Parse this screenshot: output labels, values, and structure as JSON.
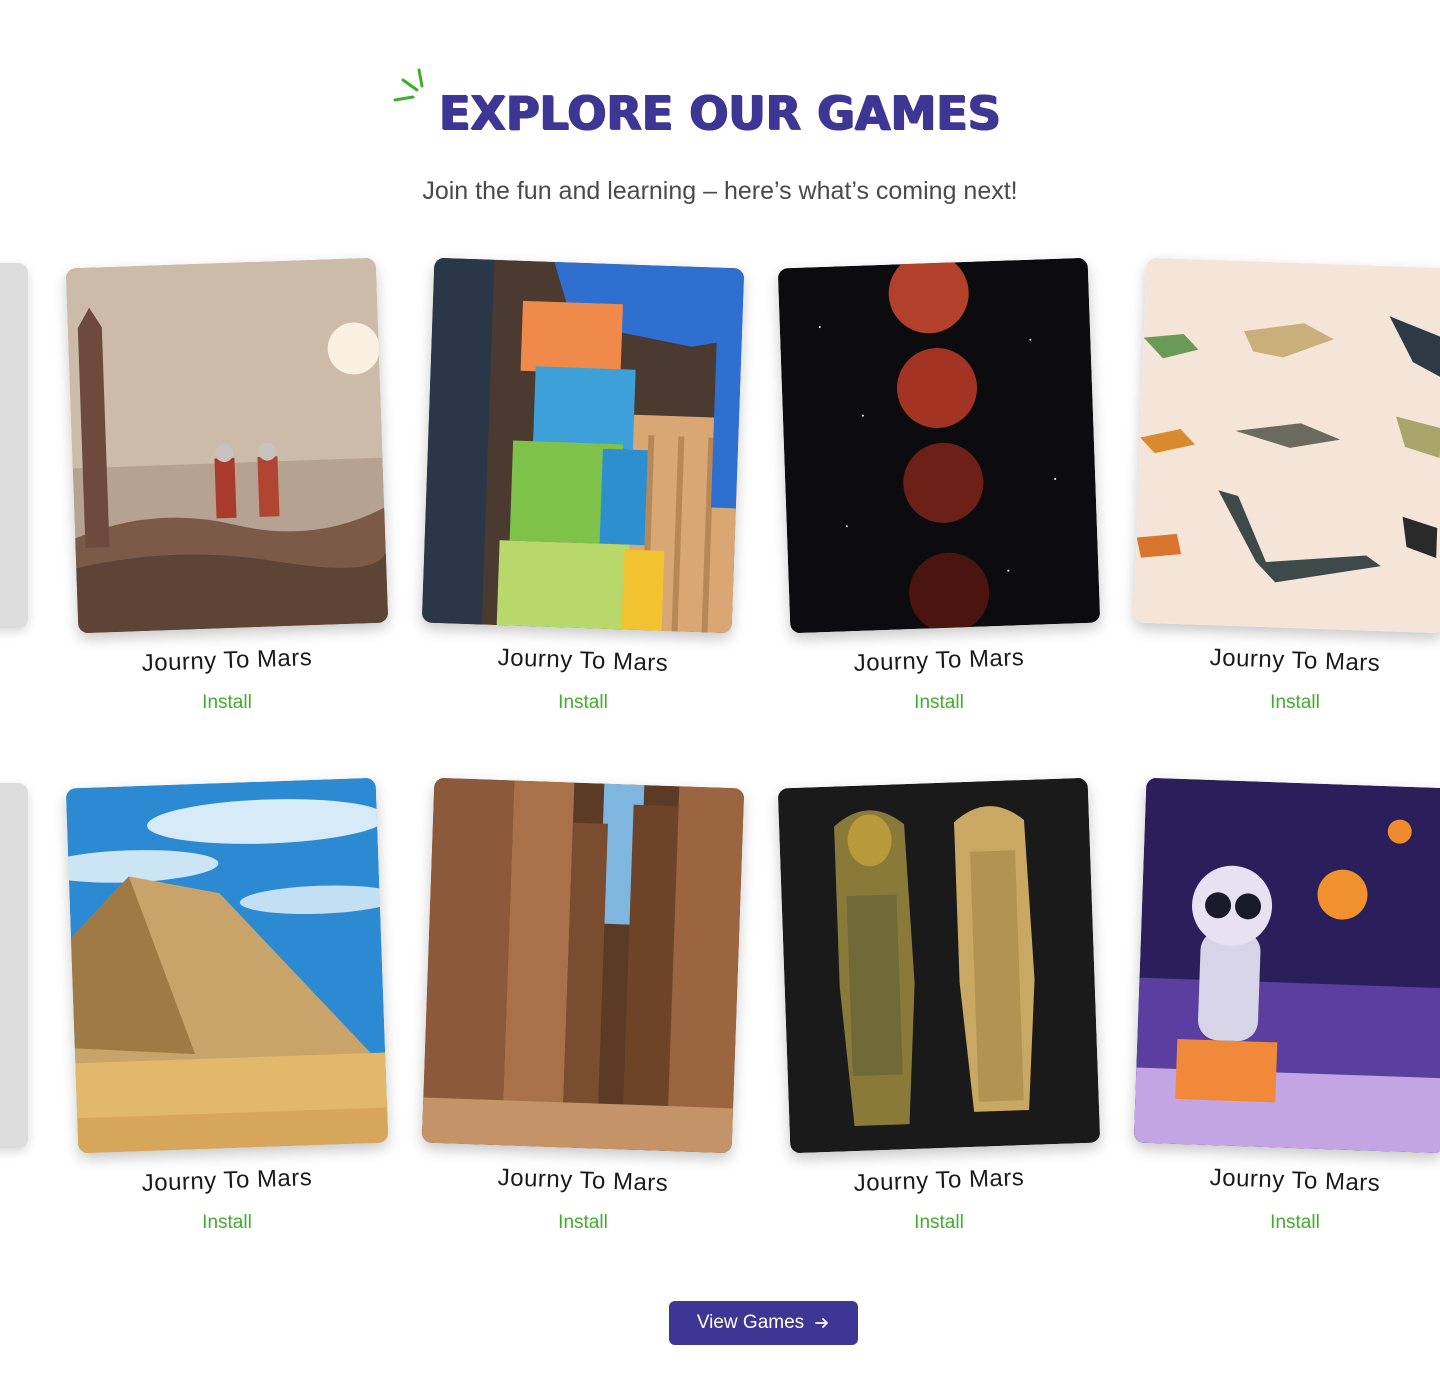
{
  "header": {
    "title": "EXPLORE OUR GAMES",
    "subtitle": "Join the fun and learning – here’s what’s coming next!"
  },
  "colors": {
    "brand": "#3d3694",
    "install": "#3fae2a",
    "sparkle": "#3fae2a"
  },
  "games": [
    {
      "name": "Journy To Mars",
      "action": "Install",
      "image": "astronauts-on-mars"
    },
    {
      "name": "Journy To Mars",
      "action": "Install",
      "image": "toy-block-tower"
    },
    {
      "name": "Journy To Mars",
      "action": "Install",
      "image": "lunar-eclipse-phases"
    },
    {
      "name": "Journy To Mars",
      "action": "Install",
      "image": "toy-dinosaurs"
    },
    {
      "name": "Journy To Mars",
      "action": "Install",
      "image": "bent-pyramid"
    },
    {
      "name": "Journy To Mars",
      "action": "Install",
      "image": "karnak-columns"
    },
    {
      "name": "Journy To Mars",
      "action": "Install",
      "image": "egyptian-sarcophagi"
    },
    {
      "name": "Journy To Mars",
      "action": "Install",
      "image": "cartoon-mummy-halloween"
    }
  ],
  "cta": {
    "label": "View Games",
    "icon": "arrow-right-icon"
  }
}
